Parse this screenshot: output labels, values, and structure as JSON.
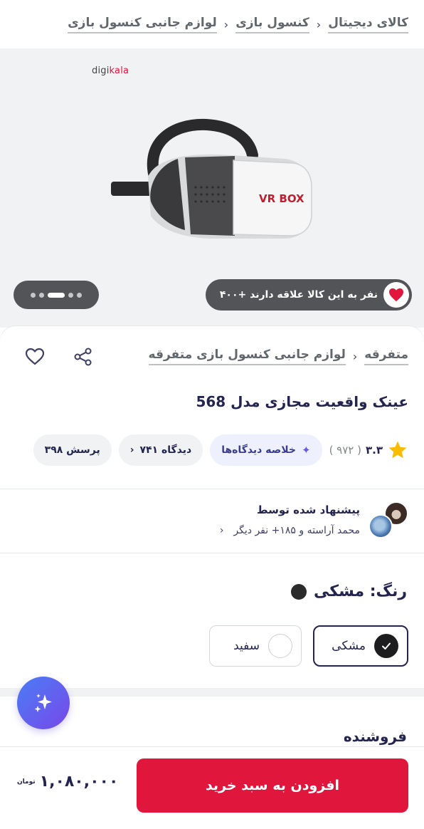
{
  "breadcrumb": [
    "کالای دیجیتال",
    "کنسول بازی",
    "لوازم جانبی کنسول بازی"
  ],
  "gallery": {
    "brand_logo": "digikala",
    "product_label": "VR BOX",
    "favorite_text": "۴۰۰+ نفر به این کالا علاقه دارند",
    "dots_total": 5,
    "dots_active_index": 2
  },
  "category": [
    "متفرقه",
    "لوازم جانبی کنسول بازی متفرقه"
  ],
  "product": {
    "title": "عینک واقعیت مجازی مدل 568",
    "rating": "۳.۳",
    "rating_count": "( ۹۷۲ )",
    "ai_summary": "خلاصه دیدگاه‌ها",
    "reviews": "۷۴۱ دیدگاه",
    "questions": "۳۹۸ پرسش"
  },
  "recommend": {
    "title": "پیشنهاد شده توسط",
    "subtitle": "محمد آراسته و ۱۸۵+ نفر دیگر"
  },
  "color": {
    "title": "رنگ: مشکی",
    "options": [
      {
        "label": "مشکی",
        "selected": true,
        "swatch": "#1d1d1f"
      },
      {
        "label": "سفید",
        "selected": false,
        "swatch": "#ffffff"
      }
    ]
  },
  "seller": {
    "title": "فروشنده"
  },
  "cart": {
    "button_label": "افزودن به سبد خرید",
    "price": "۱,۰۸۰,۰۰۰",
    "currency": "تومان"
  },
  "colors": {
    "accent": "#e0163d",
    "text": "#23254e"
  }
}
